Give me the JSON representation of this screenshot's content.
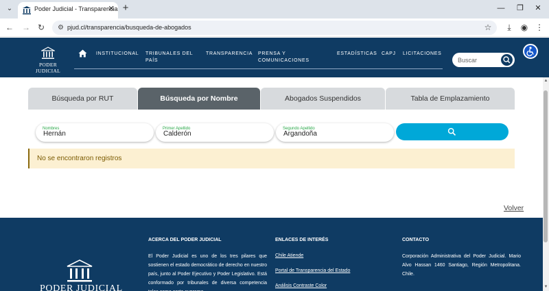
{
  "browser": {
    "tab_title": "Poder Judicial - Transparencia",
    "url": "pjud.cl/transparencia/busqueda-de-abogados"
  },
  "header": {
    "logo_text": "PODER JUDICIAL",
    "nav": [
      {
        "line1": "INSTITUCIONAL",
        "line2": ""
      },
      {
        "line1": "TRIBUNALES DEL",
        "line2": "PAÍS"
      },
      {
        "line1": "TRANSPARENCIA",
        "line2": ""
      },
      {
        "line1": "PRENSA Y",
        "line2": "COMUNICACIONES"
      },
      {
        "line1": "ESTADÍSTICAS",
        "line2": ""
      },
      {
        "line1": "CAPJ",
        "line2": ""
      },
      {
        "line1": "LICITACIONES",
        "line2": ""
      }
    ],
    "search_placeholder": "Buscar"
  },
  "tabs": [
    {
      "label": "Búsqueda por RUT",
      "active": false
    },
    {
      "label": "Búsqueda por Nombre",
      "active": true
    },
    {
      "label": "Abogados Suspendidos",
      "active": false
    },
    {
      "label": "Tabla de Emplazamiento",
      "active": false
    }
  ],
  "form": {
    "fields": [
      {
        "label": "Nombres",
        "value": "Hernán"
      },
      {
        "label": "Primer Apellido",
        "value": "Calderón"
      },
      {
        "label": "Segundo Apellido",
        "value": "Argandoña"
      }
    ]
  },
  "alert": {
    "text": "No se encontraron registros"
  },
  "back_label": "Volver",
  "footer": {
    "logo_text": "PODER JUDICIAL",
    "about": {
      "heading": "ACERCA DEL PODER JUDICIAL",
      "text": "El Poder Judicial es uno de los tres pilares que sostienen el estado democrático de derecho en nuestro país, junto al Poder Ejecutivo y Poder Legislativo. Está conformado por tribunales de diversa competencia tales como corte suprema"
    },
    "links": {
      "heading": "ENLACES DE INTERÉS",
      "items": [
        "Chile Atiende",
        "Portal de Transparencia del Estado",
        "Análisis Contraste Color"
      ]
    },
    "contact": {
      "heading": "CONTACTO",
      "text": "Corporación Administrativa del Poder Judicial. Mario Alvo Hassan 1460 Santiago, Región Metropolitana. Chile."
    }
  },
  "colors": {
    "brand": "#0f3b63",
    "accent": "#00a8d8",
    "alert_bg": "#fcf0d2",
    "active_tab": "#5a6369"
  }
}
